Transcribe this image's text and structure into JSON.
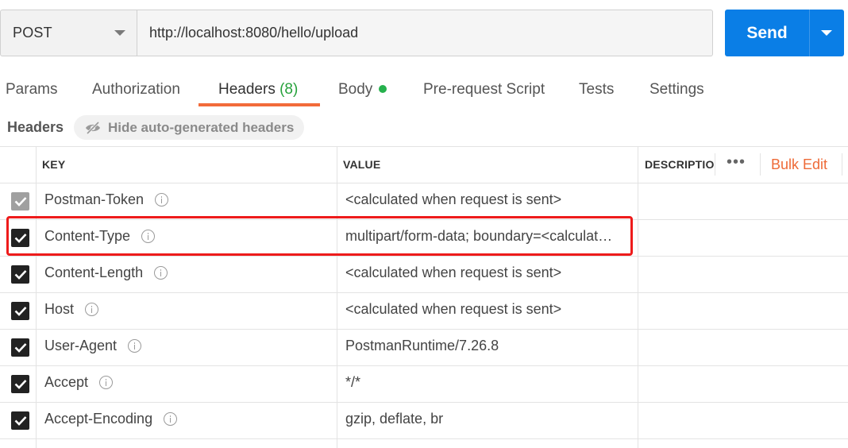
{
  "request": {
    "method": "POST",
    "url": "http://localhost:8080/hello/upload",
    "send_label": "Send"
  },
  "tabs": [
    {
      "label": "Params"
    },
    {
      "label": "Authorization"
    },
    {
      "label": "Headers",
      "count": "(8)",
      "active": true
    },
    {
      "label": "Body",
      "indicator": "green-dot"
    },
    {
      "label": "Pre-request Script"
    },
    {
      "label": "Tests"
    },
    {
      "label": "Settings"
    }
  ],
  "headers_section": {
    "title": "Headers",
    "hide_auto_label": "Hide auto-generated headers",
    "hide_icon": "eye-slash-icon"
  },
  "table": {
    "columns": {
      "key": "KEY",
      "value": "VALUE",
      "description": "DESCRIPTIO"
    },
    "more_icon": "ellipsis-icon",
    "bulk_edit_label": "Bulk Edit",
    "rows": [
      {
        "key": "Postman-Token",
        "value": "<calculated when request is sent>",
        "checked": true,
        "locked": true
      },
      {
        "key": "Content-Type",
        "value": "multipart/form-data; boundary=<calculat…",
        "checked": true,
        "highlighted": true
      },
      {
        "key": "Content-Length",
        "value": "<calculated when request is sent>",
        "checked": true
      },
      {
        "key": "Host",
        "value": "<calculated when request is sent>",
        "checked": true
      },
      {
        "key": "User-Agent",
        "value": "PostmanRuntime/7.26.8",
        "checked": true
      },
      {
        "key": "Accept",
        "value": "*/*",
        "checked": true
      },
      {
        "key": "Accept-Encoding",
        "value": "gzip, deflate, br",
        "checked": true
      }
    ]
  },
  "colors": {
    "accent": "#f26b3a",
    "send_blue": "#0a7ee6",
    "count_green": "#26a13b",
    "highlight_red": "#ee1b1b"
  }
}
